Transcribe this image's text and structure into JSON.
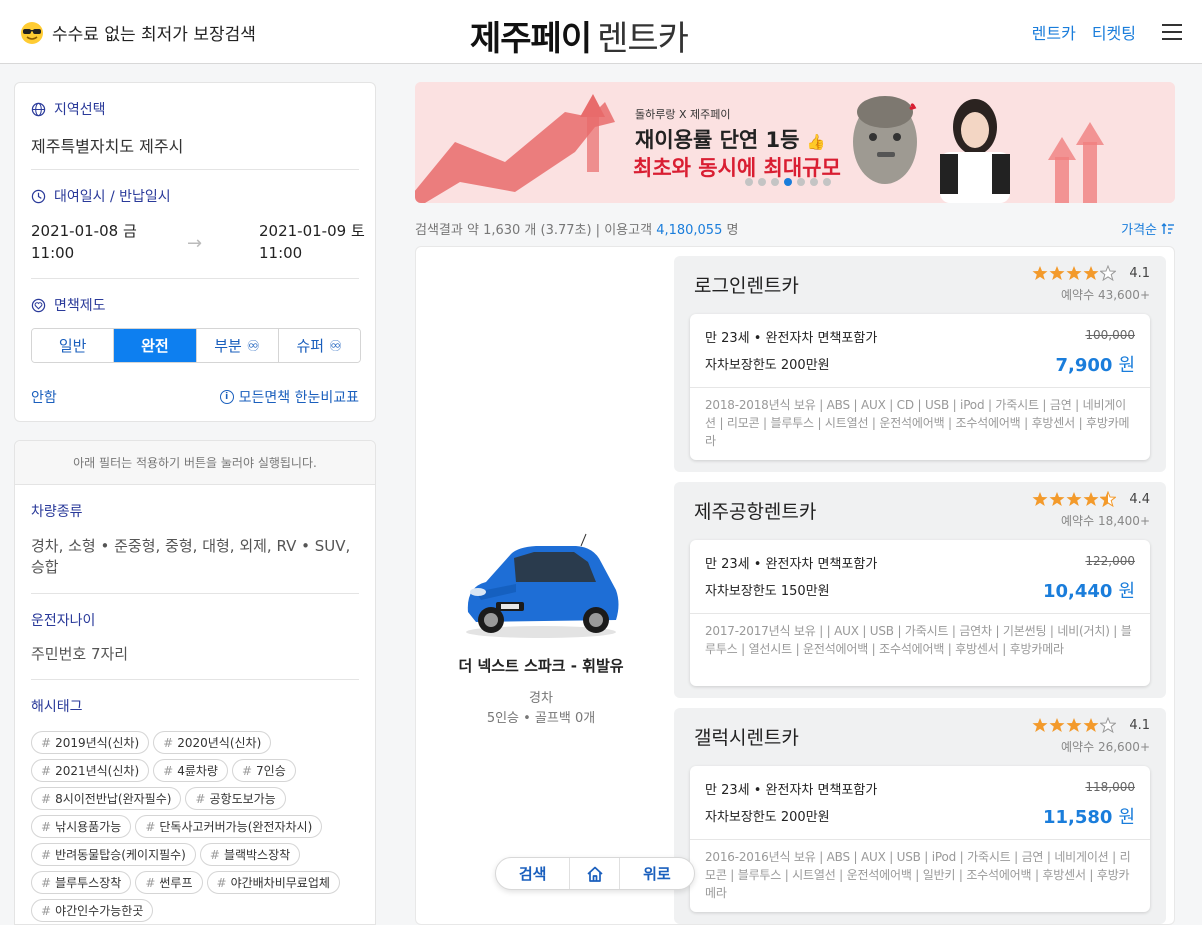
{
  "header": {
    "tagline": "수수료 없는 최저가 보장검색",
    "title_bold": "제주페이",
    "title_light": "렌트카",
    "nav": [
      "렌트카",
      "티켓팅"
    ]
  },
  "search": {
    "region_title": "지역선택",
    "region_value": "제주특별자치도 제주시",
    "rental_title": "대여일시 / 반납일시",
    "pickup_date": "2021-01-08 금",
    "pickup_time": "11:00",
    "return_date": "2021-01-09 토",
    "return_time": "11:00",
    "insurance_title": "면책제도",
    "insurance_options": [
      "일반",
      "완전",
      "부분 ♾",
      "슈퍼 ♾"
    ],
    "insurance_selected": "완전",
    "guide_link": "안함",
    "compare_link": "모든면책 한눈비교표"
  },
  "filters": {
    "note": "아래 필터는 적용하기 버튼을 눌러야 실행됩니다.",
    "car_type_title": "차량종류",
    "car_type_value": "경차, 소형 • 준중형, 중형, 대형, 외제, RV • SUV, 승합",
    "driver_age_title": "운전자나이",
    "driver_age_value": "주민번호 7자리",
    "hashtag_title": "해시태그",
    "hashtags": [
      "2019년식(신차)",
      "2020년식(신차)",
      "2021년식(신차)",
      "4륜차량",
      "7인승",
      "8시이전반납(완자필수)",
      "공항도보가능",
      "낚시용품가능",
      "단독사고커버가능(완전자차시)",
      "반려동물탑승(케이지필수)",
      "블랙박스장착",
      "블루투스장착",
      "썬루프",
      "야간배차비무료업체",
      "야간인수가능한곳"
    ]
  },
  "banner": {
    "sub": "돌하루랑 X 제주페이",
    "line1": "재이용률 단연 1등",
    "line2": "최초와 동시에 최대규모",
    "dots_count": 7,
    "active_dot": 3
  },
  "results": {
    "prefix": "검색결과 약 1,630 개 (3.77초) | 이용고객",
    "customers": "4,180,055",
    "suffix": "명",
    "sort": "가격순"
  },
  "car": {
    "name": "더 넥스트 스파크 - 휘발유",
    "class": "경차",
    "spec": "5인승 • 골프백 0개"
  },
  "companies": [
    {
      "name": "로그인렌트카",
      "rating": "4.1",
      "stars": 4,
      "bookings": "예약수 43,600+",
      "condition": "만 23세 • 완전자차 면책포함가",
      "coverage": "자차보장한도 200만원",
      "original_price": "100,000",
      "price": "7,900",
      "unit": "원",
      "options": "2018-2018년식 보유 | ABS | AUX | CD | USB | iPod | 가죽시트 | 금연 | 네비게이션 | 리모콘 | 블루투스 | 시트열선 | 운전석에어백 | 조수석에어백 | 후방센서 | 후방카메라"
    },
    {
      "name": "제주공항렌트카",
      "rating": "4.4",
      "stars": 4.5,
      "bookings": "예약수 18,400+",
      "condition": "만 23세 • 완전자차 면책포함가",
      "coverage": "자차보장한도 150만원",
      "original_price": "122,000",
      "price": "10,440",
      "unit": "원",
      "options": "2017-2017년식 보유 | | AUX | USB | 가죽시트 | 금연차 | 기본썬팅 | 네비(거치) | 블루투스 | 열선시트 | 운전석에어백 | 조수석에어백 | 후방센서 | 후방카메라"
    },
    {
      "name": "갤럭시렌트카",
      "rating": "4.1",
      "stars": 4,
      "bookings": "예약수 26,600+",
      "condition": "만 23세 • 완전자차 면책포함가",
      "coverage": "자차보장한도 200만원",
      "original_price": "118,000",
      "price": "11,580",
      "unit": "원",
      "options": "2016-2016년식 보유 | ABS | AUX | USB | iPod | 가죽시트 | 금연 | 네비게이션 | 리모콘 | 블루투스 | 시트열선 | 운전석에어백 | 일반키 | 조수석에어백 | 후방센서 | 후방카메라"
    }
  ],
  "float_nav": {
    "search": "검색",
    "up": "위로"
  },
  "colors": {
    "accent": "#1a7ddb",
    "selected": "#0d7ff0",
    "star": "#f39a2b",
    "section_title": "#2a3a9a",
    "banner_red": "#d91e32"
  }
}
